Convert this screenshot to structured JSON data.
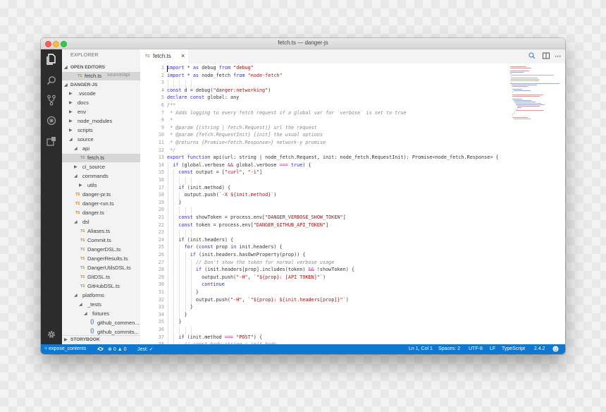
{
  "window": {
    "title": "fetch.ts — danger-js"
  },
  "explorer": {
    "header": "EXPLORER",
    "open_editors_label": "OPEN EDITORS",
    "open_file": {
      "name": "fetch.ts",
      "path": "source/api"
    },
    "project_label": "DANGER-JS",
    "storybook_label": "STORYBOOK",
    "tree": [
      {
        "label": ".vscode",
        "type": "folder",
        "expanded": false
      },
      {
        "label": "docs",
        "type": "folder",
        "expanded": false
      },
      {
        "label": "env",
        "type": "folder",
        "expanded": false
      },
      {
        "label": "node_modules",
        "type": "folder",
        "expanded": false
      },
      {
        "label": "scripts",
        "type": "folder",
        "expanded": false
      },
      {
        "label": "source",
        "type": "folder",
        "expanded": true
      },
      {
        "label": "api",
        "type": "folder",
        "expanded": true
      },
      {
        "label": "fetch.ts",
        "type": "ts",
        "selected": true
      },
      {
        "label": "ci_source",
        "type": "folder",
        "expanded": false
      },
      {
        "label": "commands",
        "type": "folder",
        "expanded": true
      },
      {
        "label": "utils",
        "type": "folder",
        "expanded": false
      },
      {
        "label": "danger-pr.ts",
        "type": "ts"
      },
      {
        "label": "danger-run.ts",
        "type": "ts"
      },
      {
        "label": "danger.ts",
        "type": "ts"
      },
      {
        "label": "dsl",
        "type": "folder",
        "expanded": true
      },
      {
        "label": "Aliases.ts",
        "type": "ts"
      },
      {
        "label": "Commit.ts",
        "type": "ts"
      },
      {
        "label": "DangerDSL.ts",
        "type": "ts"
      },
      {
        "label": "DangerResults.ts",
        "type": "ts"
      },
      {
        "label": "DangerUtilsDSL.ts",
        "type": "ts"
      },
      {
        "label": "GitDSL.ts",
        "type": "ts"
      },
      {
        "label": "GitHubDSL.ts",
        "type": "ts"
      },
      {
        "label": "platforms",
        "type": "folder",
        "expanded": true
      },
      {
        "label": "_tests",
        "type": "folder",
        "expanded": true
      },
      {
        "label": "fixtures",
        "type": "folder",
        "expanded": true
      },
      {
        "label": "github_commen...",
        "type": "json"
      },
      {
        "label": "github_commits...",
        "type": "json"
      }
    ]
  },
  "tab": {
    "label": "fetch.ts",
    "badge": "TS",
    "close": "×"
  },
  "code_lines": [
    "import * as debug from \"debug\"",
    "import * as node_fetch from \"node-fetch\"",
    "",
    "const d = debug(\"danger:networking\")",
    "declare const global: any",
    "/**",
    " * Adds logging to every fetch request if a global var for `verbose` is set to true",
    " *",
    " * @param {(string | fetch.Request)} url the request",
    " * @param {fetch.RequestInit} [init] the usual options",
    " * @returns {Promise<fetch.Response>} network-y promise",
    " */",
    "export function api(url: string | node_fetch.Request, init: node_fetch.RequestInit): Promise<node_fetch.Response> {",
    "  if (global.verbose && global.verbose === true) {",
    "    const output = [\"curl\", \"-i\"]",
    "",
    "    if (init.method) {",
    "      output.push(`-X ${init.method}`)",
    "    }",
    "",
    "    const showToken = process.env[\"DANGER_VERBOSE_SHOW_TOKEN\"]",
    "    const token = process.env[\"DANGER_GITHUB_API_TOKEN\"]",
    "",
    "    if (init.headers) {",
    "      for (const prop in init.headers) {",
    "        if (init.headers.hasOwnProperty(prop)) {",
    "          // Don't show the token for normal verbose usage",
    "          if (init.headers[prop].includes(token) && !showToken) {",
    "            output.push(\"-H\", `\"${prop}: [API TOKEN]\"`)",
    "            continue",
    "          }",
    "          output.push(\"-H\", `\"${prop}: ${init.headers[prop]}\"`)",
    "        }",
    "      }",
    "    }",
    "",
    "    if (init.method === \"POST\") {",
    "      // const body:string = init.body"
  ],
  "status": {
    "branch": "expose_contents",
    "errors": "0",
    "warnings": "0",
    "jest": "Jest:",
    "position": "Ln 1, Col 1",
    "spaces": "Spaces: 2",
    "encoding": "UTF-8",
    "eol": "LF",
    "language": "TypeScript",
    "version": "2.4.2"
  },
  "colors": {
    "statusbar": "#0e78d1",
    "activity_bar": "#2c2c2c",
    "sidebar": "#f3f3f3"
  }
}
